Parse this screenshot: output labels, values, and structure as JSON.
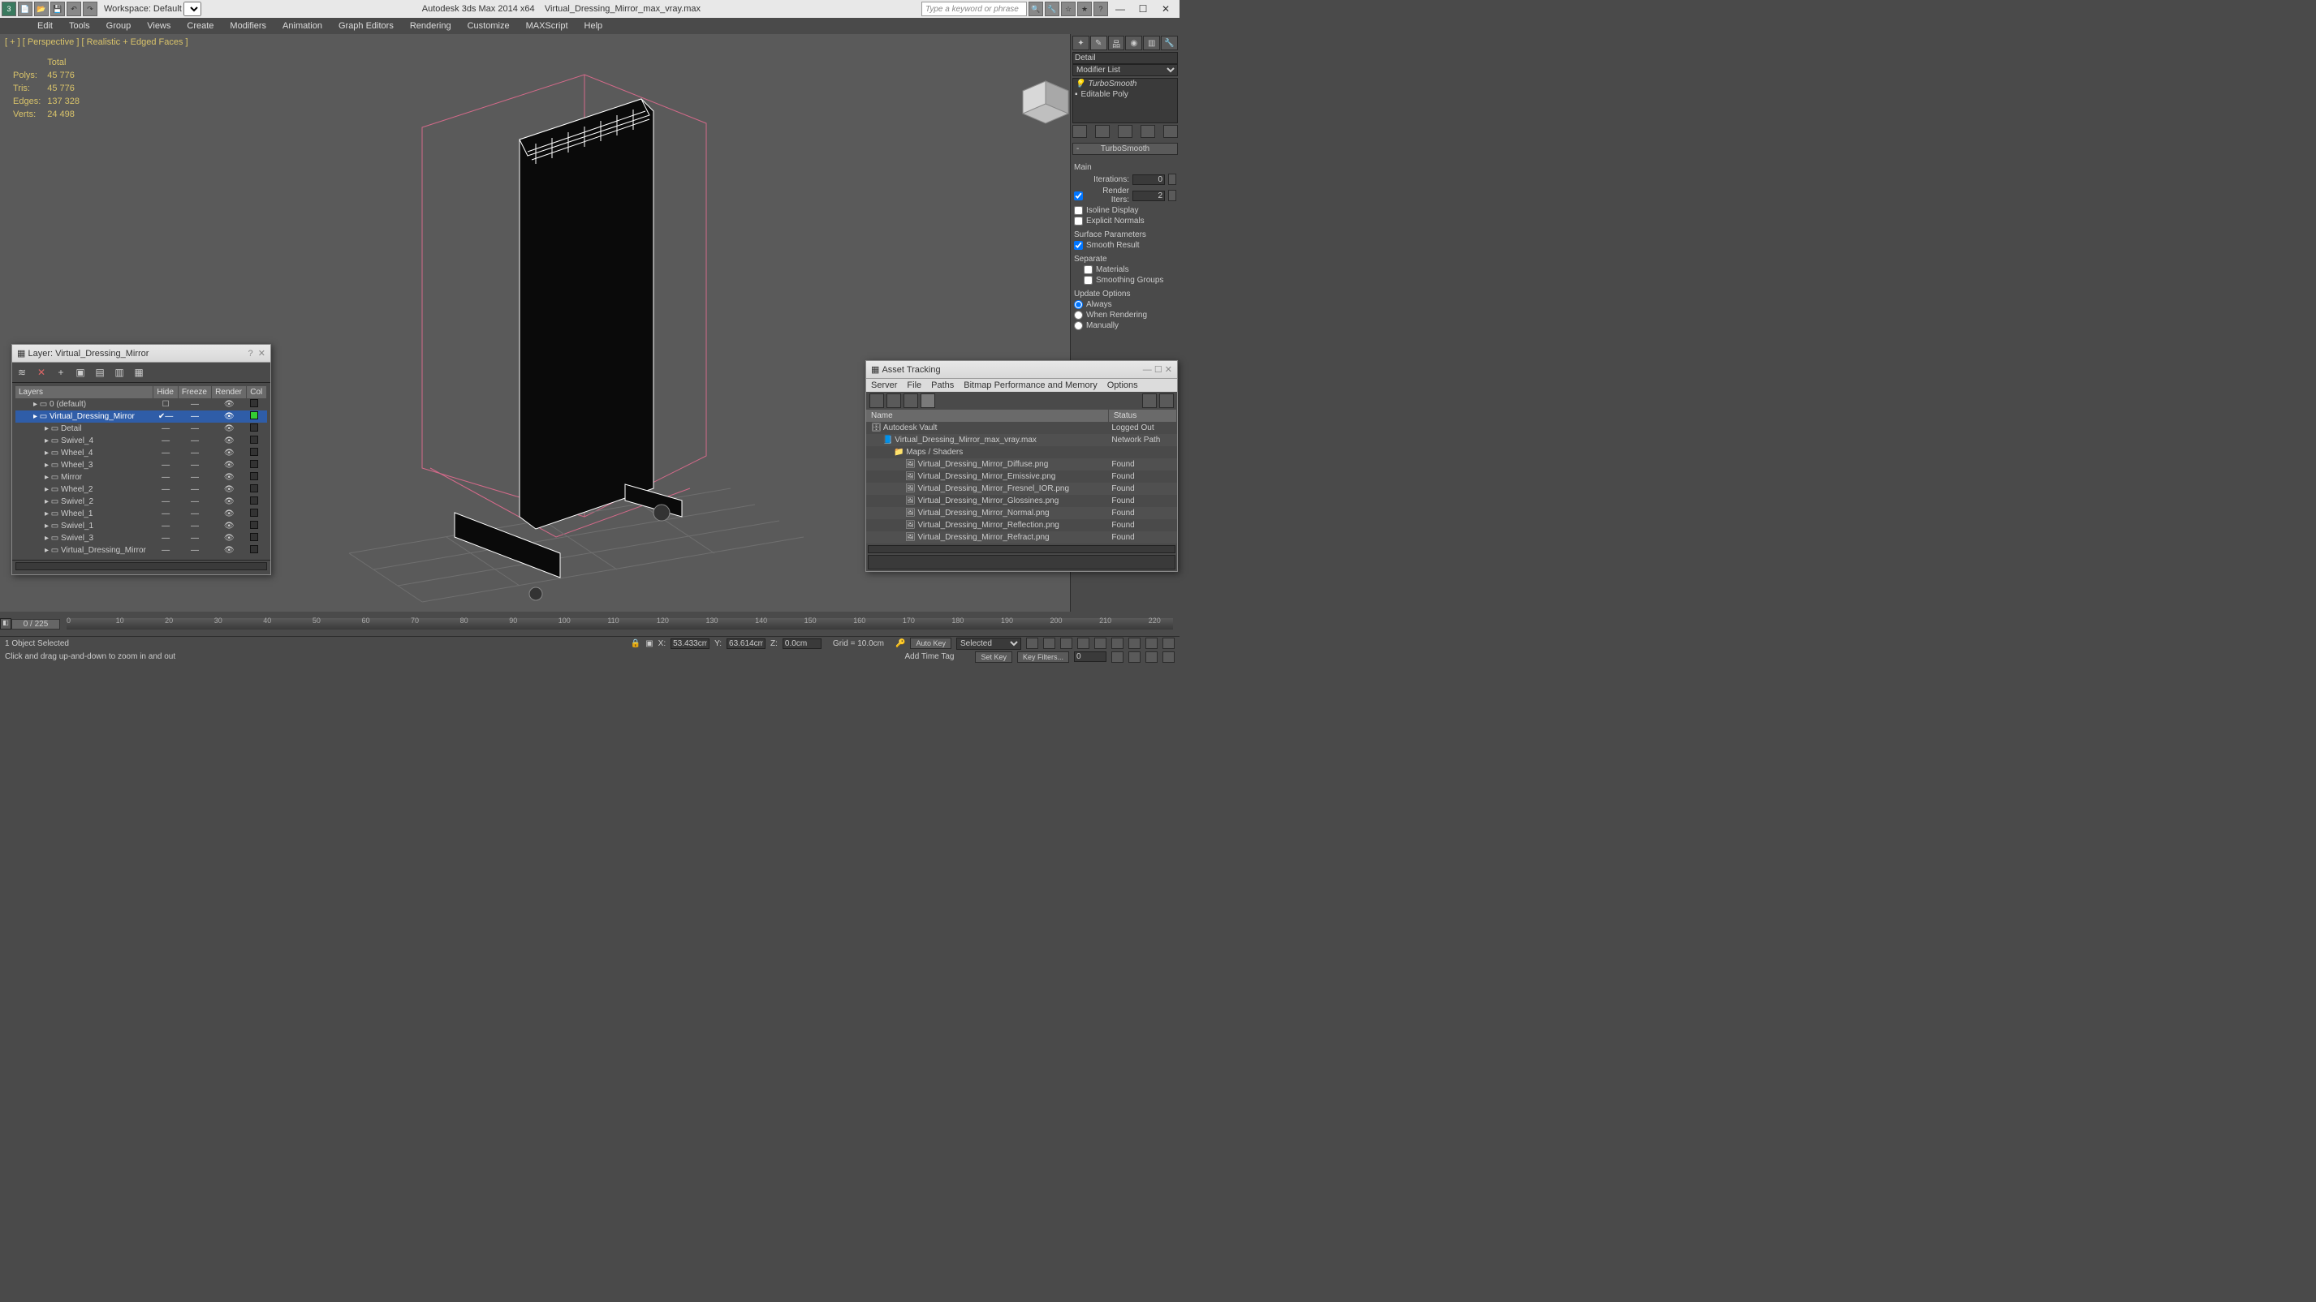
{
  "app": {
    "title_left": "Autodesk 3ds Max  2014 x64",
    "title_file": "Virtual_Dressing_Mirror_max_vray.max",
    "workspace_label": "Workspace: Default",
    "search_placeholder": "Type a keyword or phrase"
  },
  "menu": [
    "Edit",
    "Tools",
    "Group",
    "Views",
    "Create",
    "Modifiers",
    "Animation",
    "Graph Editors",
    "Rendering",
    "Customize",
    "MAXScript",
    "Help"
  ],
  "viewport": {
    "label": "[ + ] [ Perspective ] [ Realistic + Edged Faces ]",
    "stats_header": "Total",
    "stats": {
      "polys_l": "Polys:",
      "polys": "45 776",
      "tris_l": "Tris:",
      "tris": "45 776",
      "edges_l": "Edges:",
      "edges": "137 328",
      "verts_l": "Verts:",
      "verts": "24 498"
    }
  },
  "rpanel": {
    "detail": "Detail",
    "modlist": "Modifier List",
    "stack": [
      "TurboSmooth",
      "Editable Poly"
    ],
    "rollout": "TurboSmooth",
    "main": "Main",
    "iterations_l": "Iterations:",
    "iterations": "0",
    "render_iters_l": "Render Iters:",
    "render_iters": "2",
    "isoline": "Isoline Display",
    "explicit": "Explicit Normals",
    "surface_params": "Surface Parameters",
    "smooth_result": "Smooth Result",
    "separate": "Separate",
    "materials": "Materials",
    "smoothing_groups": "Smoothing Groups",
    "update_options": "Update Options",
    "update": {
      "always": "Always",
      "when": "When Rendering",
      "manually": "Manually"
    }
  },
  "layer_dlg": {
    "title": "Layer: Virtual_Dressing_Mirror",
    "cols": [
      "Layers",
      "Hide",
      "Freeze",
      "Render",
      "Col"
    ],
    "rows": [
      {
        "name": "0 (default)",
        "indent": 1,
        "sel": false,
        "box": true
      },
      {
        "name": "Virtual_Dressing_Mirror",
        "indent": 1,
        "sel": true,
        "check": true
      },
      {
        "name": "Detail",
        "indent": 2
      },
      {
        "name": "Swivel_4",
        "indent": 2
      },
      {
        "name": "Wheel_4",
        "indent": 2
      },
      {
        "name": "Wheel_3",
        "indent": 2
      },
      {
        "name": "Mirror",
        "indent": 2
      },
      {
        "name": "Wheel_2",
        "indent": 2
      },
      {
        "name": "Swivel_2",
        "indent": 2
      },
      {
        "name": "Wheel_1",
        "indent": 2
      },
      {
        "name": "Swivel_1",
        "indent": 2
      },
      {
        "name": "Swivel_3",
        "indent": 2
      },
      {
        "name": "Virtual_Dressing_Mirror",
        "indent": 2
      }
    ]
  },
  "asset_dlg": {
    "title": "Asset Tracking",
    "menu": [
      "Server",
      "File",
      "Paths",
      "Bitmap Performance and Memory",
      "Options"
    ],
    "cols": [
      "Name",
      "Status"
    ],
    "rows": [
      {
        "name": "Autodesk Vault",
        "status": "Logged Out",
        "indent": 0,
        "type": "vault"
      },
      {
        "name": "Virtual_Dressing_Mirror_max_vray.max",
        "status": "Network Path",
        "indent": 1,
        "type": "max"
      },
      {
        "name": "Maps / Shaders",
        "status": "",
        "indent": 2,
        "type": "folder"
      },
      {
        "name": "Virtual_Dressing_Mirror_Diffuse.png",
        "status": "Found",
        "indent": 3,
        "type": "img"
      },
      {
        "name": "Virtual_Dressing_Mirror_Emissive.png",
        "status": "Found",
        "indent": 3,
        "type": "img"
      },
      {
        "name": "Virtual_Dressing_Mirror_Fresnel_IOR.png",
        "status": "Found",
        "indent": 3,
        "type": "img"
      },
      {
        "name": "Virtual_Dressing_Mirror_Glossines.png",
        "status": "Found",
        "indent": 3,
        "type": "img"
      },
      {
        "name": "Virtual_Dressing_Mirror_Normal.png",
        "status": "Found",
        "indent": 3,
        "type": "img"
      },
      {
        "name": "Virtual_Dressing_Mirror_Reflection.png",
        "status": "Found",
        "indent": 3,
        "type": "img"
      },
      {
        "name": "Virtual_Dressing_Mirror_Refract.png",
        "status": "Found",
        "indent": 3,
        "type": "img"
      }
    ]
  },
  "timeline": {
    "frame": "0 / 225",
    "ticks": [
      0,
      10,
      20,
      30,
      40,
      50,
      60,
      70,
      80,
      90,
      100,
      110,
      120,
      130,
      140,
      150,
      160,
      170,
      180,
      190,
      200,
      210,
      220
    ]
  },
  "status": {
    "selected": "1 Object Selected",
    "prompt": "Click and drag up-and-down to zoom in and out",
    "x_l": "X:",
    "x": "53.433cm",
    "y_l": "Y:",
    "y": "63.614cm",
    "z_l": "Z:",
    "z": "0.0cm",
    "grid_l": "Grid = 10.0cm",
    "autokey": "Auto Key",
    "selected_mode": "Selected",
    "setkey": "Set Key",
    "keyfilters": "Key Filters...",
    "addtimetag": "Add Time Tag"
  }
}
